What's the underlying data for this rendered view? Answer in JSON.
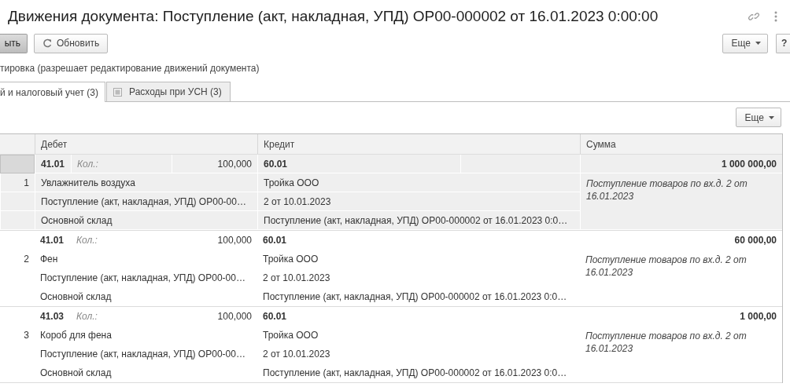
{
  "window": {
    "title": "Движения документа: Поступление (акт, накладная, УПД) ОР00-000002 от 16.01.2023 0:00:00"
  },
  "toolbar": {
    "buttons": [
      {
        "label": "ыть",
        "kind": "default"
      },
      {
        "label": "Обновить",
        "kind": "refresh"
      }
    ],
    "more": "Еще",
    "help": "?"
  },
  "hint": "тировка (разрешает редактирование движений документа)",
  "tabs": [
    {
      "label": "й и налоговый учет (3)",
      "selected": true
    },
    {
      "label": "Расходы при УСН (3)",
      "selected": false
    }
  ],
  "table": {
    "more": "Еще",
    "columns": [
      "Дебет",
      "Кредит",
      "Сумма"
    ],
    "rows": [
      {
        "selected": true,
        "number": "1",
        "debit": {
          "account": "41.01",
          "qty_label": "Кол.:",
          "qty": "100,000",
          "lines": [
            "Увлажнитель воздуха",
            "Поступление (акт, накладная, УПД) ОР00-00…",
            "Основной склад"
          ]
        },
        "credit": {
          "account": "60.01",
          "lines": [
            "Тройка ООО",
            "2 от 10.01.2023",
            "Поступление (акт, накладная, УПД) ОР00-000002 от 16.01.2023 0:0…"
          ]
        },
        "amount": "1 000 000,00",
        "comment": "Поступление товаров по вх.д. 2 от 16.01.2023"
      },
      {
        "selected": false,
        "number": "2",
        "debit": {
          "account": "41.01",
          "qty_label": "Кол.:",
          "qty": "100,000",
          "lines": [
            "Фен",
            "Поступление (акт, накладная, УПД) ОР00-00…",
            "Основной склад"
          ]
        },
        "credit": {
          "account": "60.01",
          "lines": [
            "Тройка ООО",
            "2 от 10.01.2023",
            "Поступление (акт, накладная, УПД) ОР00-000002 от 16.01.2023 0:0…"
          ]
        },
        "amount": "60 000,00",
        "comment": "Поступление товаров по вх.д. 2 от 16.01.2023"
      },
      {
        "selected": false,
        "number": "3",
        "debit": {
          "account": "41.03",
          "qty_label": "Кол.:",
          "qty": "100,000",
          "lines": [
            "Короб для фена",
            "Поступление (акт, накладная, УПД) ОР00-00…",
            "Основной склад"
          ]
        },
        "credit": {
          "account": "60.01",
          "lines": [
            "Тройка ООО",
            "2 от 10.01.2023",
            "Поступление (акт, накладная, УПД) ОР00-000002 от 16.01.2023 0:0…"
          ]
        },
        "amount": "1 000,00",
        "comment": "Поступление товаров по вх.д. 2 от 16.01.2023"
      }
    ]
  }
}
